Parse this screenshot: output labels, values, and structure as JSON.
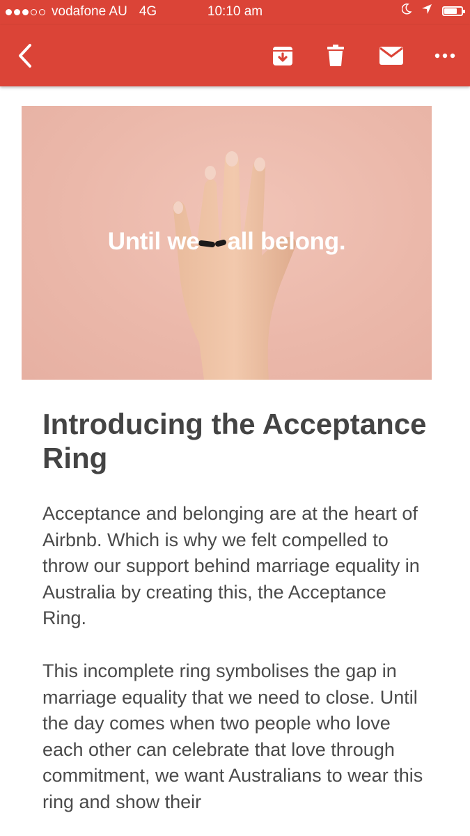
{
  "status_bar": {
    "carrier": "vodafone AU",
    "network": "4G",
    "time": "10:10 am",
    "signal_bars_filled": 3,
    "signal_bars_total": 5
  },
  "toolbar": {
    "background_color": "#db4437",
    "icons": [
      "back-arrow-icon",
      "archive-icon",
      "trash-icon",
      "mail-icon",
      "more-icon"
    ]
  },
  "hero": {
    "caption_left": "Until we",
    "caption_right": "all belong.",
    "background_color": "#ebb8aa"
  },
  "article": {
    "headline": "Introducing the Acceptance Ring",
    "paragraphs": [
      "Acceptance and belonging are at the heart of Airbnb. Which is why we felt compelled to throw our support behind marriage equality in Australia by creating this, the Acceptance Ring.",
      "This incomplete ring symbolises the gap in marriage equality that we need to close. Until the day comes when two people who love each other can celebrate that love through commitment, we want Australians to wear this ring and show their"
    ]
  }
}
